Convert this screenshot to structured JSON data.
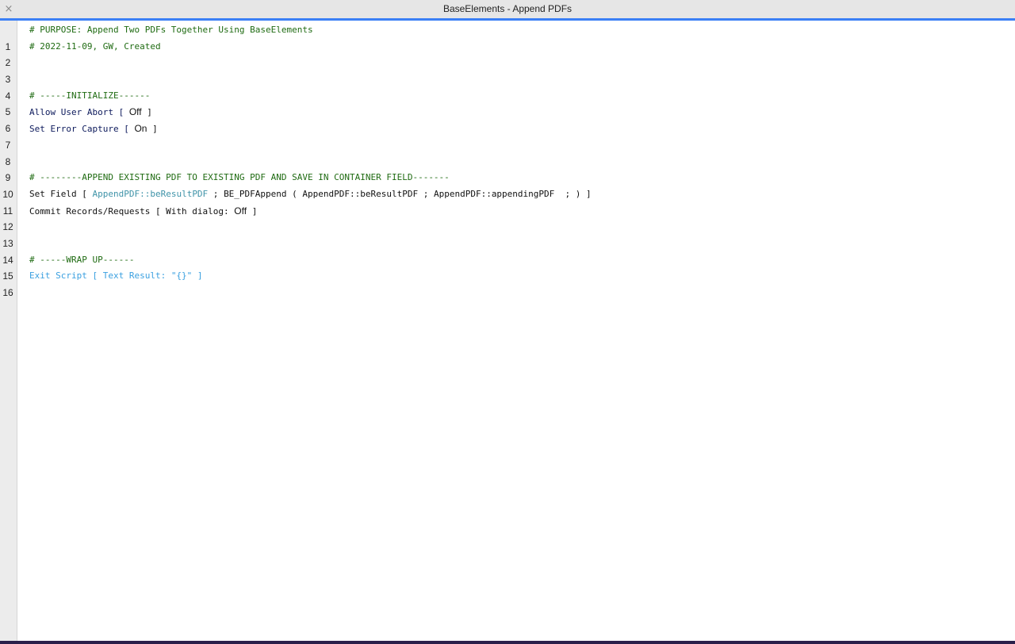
{
  "window": {
    "title": "BaseElements - Append PDFs",
    "close_glyph": "×"
  },
  "lines": [
    {
      "num": "1",
      "parts": [
        "# PURPOSE: Append Two PDFs Together Using BaseElements"
      ]
    },
    {
      "num": "2",
      "parts": [
        "# 2022-11-09, GW, Created"
      ]
    },
    {
      "num": "3",
      "parts": [
        ""
      ]
    },
    {
      "num": "4",
      "parts": [
        ""
      ]
    },
    {
      "num": "5",
      "parts": [
        "# -----INITIALIZE------"
      ]
    },
    {
      "num": "6",
      "parts": [
        "Allow User Abort [ ",
        "Off",
        " ]"
      ]
    },
    {
      "num": "7",
      "parts": [
        "Set Error Capture [ ",
        "On",
        " ]"
      ]
    },
    {
      "num": "8",
      "parts": [
        ""
      ]
    },
    {
      "num": "9",
      "parts": [
        ""
      ]
    },
    {
      "num": "10",
      "parts": [
        "# --------APPEND EXISTING PDF TO EXISTING PDF AND SAVE IN CONTAINER FIELD-------"
      ]
    },
    {
      "num": "11",
      "parts": [
        "Set Field [ ",
        "AppendPDF::beResultPDF",
        " ; ",
        "BE_PDFAppend ( AppendPDF::beResultPDF ; AppendPDF::appendingPDF  ; ) ]"
      ]
    },
    {
      "num": "12",
      "parts": [
        "Commit Records/Requests [ With dialog: ",
        "Off",
        " ]"
      ]
    },
    {
      "num": "13",
      "parts": [
        ""
      ]
    },
    {
      "num": "14",
      "parts": [
        ""
      ]
    },
    {
      "num": "15",
      "parts": [
        "# -----WRAP UP------"
      ]
    },
    {
      "num": "16",
      "parts": [
        "Exit Script [ Text Result: ",
        "\"{}\"",
        " ]"
      ]
    }
  ],
  "colors": {
    "comment": "#1f6b12",
    "step": "#0d1a5c",
    "field": "#3f93a8",
    "disabled_step": "#3aa0e0",
    "titlebar_accent": "#3b7ff5"
  }
}
